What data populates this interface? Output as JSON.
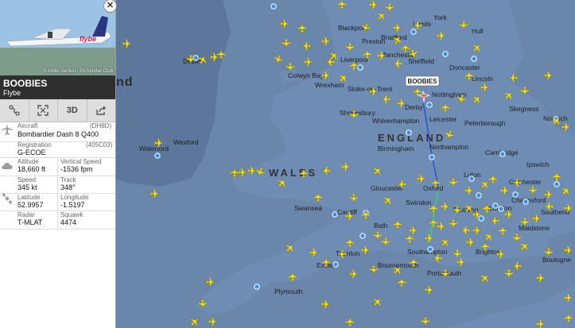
{
  "aircraft_card": {
    "photo_credit": "© Attilio Venturi - Pli Spotter Club",
    "photo_livery": "flybe",
    "callsign": "BOOBIES",
    "airline": "Flybe",
    "toolbar": {
      "route_icon": "route-icon",
      "fullscreen_icon": "expand-icon",
      "view_3d_label": "3D",
      "share_icon": "share-icon"
    },
    "fields": {
      "aircraft_label": "Aircraft",
      "aircraft_code": "(DH8D)",
      "aircraft_value": "Bombardier Dash 8 Q400",
      "registration_label": "Registration",
      "registration_code": "(405C03)",
      "registration_value": "G-ECOE",
      "altitude_label": "Altitude",
      "altitude_value": "18,660 ft",
      "vspeed_label": "Vertical Speed",
      "vspeed_value": "-1536 fpm",
      "speed_label": "Speed",
      "speed_value": "345 kt",
      "track_label": "Track",
      "track_value": "348°",
      "latitude_label": "Latitude",
      "latitude_value": "52.9957",
      "longitude_label": "Longitude",
      "longitude_value": "-1.5197",
      "radar_label": "Radar",
      "radar_value": "T-MLAT",
      "squawk_label": "Squawk",
      "squawk_value": "4474"
    }
  },
  "map": {
    "flight_tag": "BOOBIES",
    "region_labels": {
      "england": "ENGLAND",
      "wales": "WALES",
      "ireland_fragment": "nd"
    },
    "places": [
      "Leeds",
      "Hull",
      "Blackpool",
      "Bradford",
      "York",
      "Preston",
      "Liverpool",
      "Manchester",
      "Sheffield",
      "Dublin",
      "Doncaster",
      "Lincoln",
      "Wrexham",
      "Stoke-on-Trent",
      "Colwyn Bay",
      "Nottingham",
      "Derby",
      "Skegness",
      "Shrewsbury",
      "Leicester",
      "Wolverhampton",
      "Peterborough",
      "Birmingham",
      "Norwich",
      "Northampton",
      "Cambridge",
      "Waterford",
      "Wexford",
      "Ipswich",
      "Colchester",
      "Swansea",
      "Gloucester",
      "Oxford",
      "Cardiff",
      "Bath",
      "Swindon",
      "Reading",
      "London",
      "Maidstone",
      "Taunton",
      "Exeter",
      "Southampton",
      "Portsmouth",
      "Bournemouth",
      "Plymouth",
      "Brighton",
      "Boulogne",
      "Luton",
      "Chelmsford",
      "Southend"
    ],
    "colors": {
      "land": "#6e8ab0",
      "land_dark": "#5b7399",
      "sea": "#6c88ad",
      "plane": "#f4e22a",
      "airport": "#3d8fe0",
      "trail_blue": "#2a55d4",
      "trail_green": "#3ccf6a"
    }
  }
}
